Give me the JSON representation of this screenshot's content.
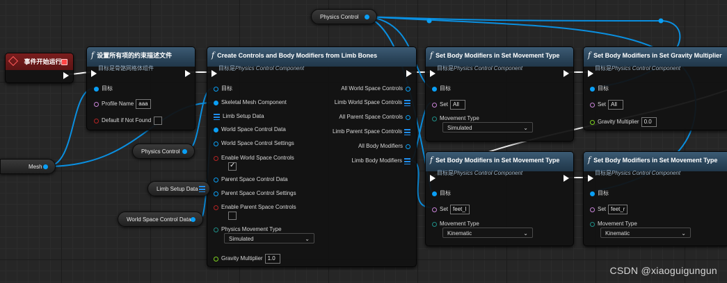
{
  "event_node": {
    "title": "事件开始运行"
  },
  "profile_node": {
    "icon": "f",
    "title": "设置所有项的约束描述文件",
    "subtitle": "目标是骨骼网格体组件",
    "pin_target": "目标",
    "pin_profile_name": "Profile Name",
    "profile_name_value": "aaa",
    "pin_default": "Default if Not Found"
  },
  "create_node": {
    "icon": "f",
    "title": "Create Controls and Body Modifiers from Limb Bones",
    "subtitle_prefix": "目标是",
    "subtitle_class": "Physics Control Component",
    "inputs": {
      "target": "目标",
      "skeletal": "Skeletal Mesh Component",
      "limb_setup": "Limb Setup Data",
      "ws_control_data": "World Space Control Data",
      "ws_control_settings": "World Space Control Settings",
      "enable_ws": "Enable World Space Controls",
      "ps_control_data": "Parent Space Control Data",
      "ps_control_settings": "Parent Space Control Settings",
      "enable_ps": "Enable Parent Space Controls",
      "phys_movement_type": "Physics Movement Type",
      "phys_movement_value": "Simulated",
      "gravity": "Gravity Multiplier",
      "gravity_value": "1.0"
    },
    "outputs": {
      "all_ws": "All World Space Controls",
      "limb_ws": "Limb World Space Controls",
      "all_ps": "All Parent Space Controls",
      "limb_ps": "Limb Parent Space Controls",
      "all_bm": "All Body Modifiers",
      "limb_bm": "Limb Body Modifiers"
    }
  },
  "movement_node_1": {
    "icon": "f",
    "title": "Set Body Modifiers in Set Movement Type",
    "subtitle_prefix": "目标是",
    "subtitle_class": "Physics Control Component",
    "pin_target": "目标",
    "pin_set": "Set",
    "set_value": "All",
    "pin_movement": "Movement Type",
    "movement_value": "Simulated"
  },
  "gravity_node": {
    "icon": "f",
    "title": "Set Body Modifiers in Set Gravity Multiplier",
    "subtitle_prefix": "目标是",
    "subtitle_class": "Physics Control Component",
    "pin_target": "目标",
    "pin_set": "Set",
    "set_value": "All",
    "pin_gravity": "Gravity Multiplier",
    "gravity_value": "0.0"
  },
  "movement_node_2": {
    "icon": "f",
    "title": "Set Body Modifiers in Set Movement Type",
    "subtitle_prefix": "目标是",
    "subtitle_class": "Physics Control Component",
    "pin_target": "目标",
    "pin_set": "Set",
    "set_value": "feet_l",
    "pin_movement": "Movement Type",
    "movement_value": "Kinematic"
  },
  "movement_node_3": {
    "icon": "f",
    "title": "Set Body Modifiers in Set Movement Type",
    "subtitle_prefix": "目标是",
    "subtitle_class": "Physics Control Component",
    "pin_target": "目标",
    "pin_set": "Set",
    "set_value": "feet_r",
    "pin_movement": "Movement Type",
    "movement_value": "Kinematic"
  },
  "variables": {
    "physics_control_top": "Physics Control",
    "physics_control_mid": "Physics Control",
    "mesh": "Mesh",
    "limb_setup_data": "Limb Setup Data",
    "world_space_control_data": "World Space Control Data"
  },
  "watermark": "CSDN @xiaoguigungun",
  "colors": {
    "object_pin": "#0a9ff5",
    "exec_wire": "#ffffff",
    "node_header": "#2a4459",
    "event_header": "#7a1e1e"
  }
}
